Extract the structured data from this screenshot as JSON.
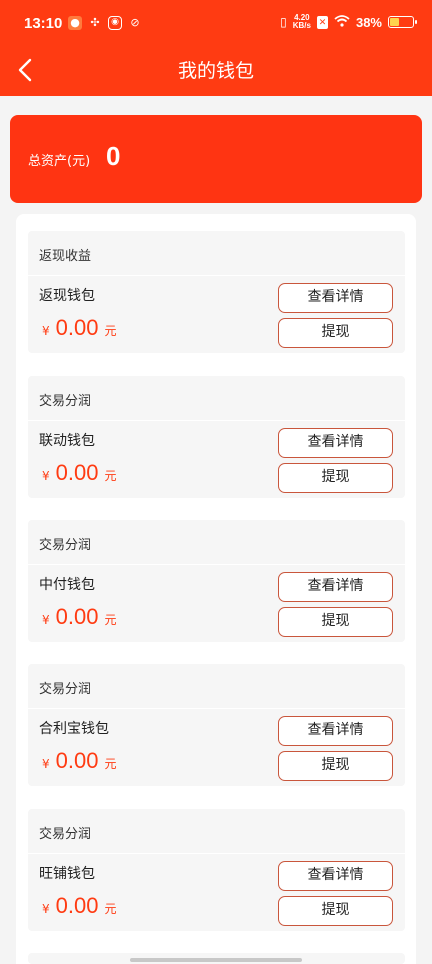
{
  "status_bar": {
    "time": "13:10",
    "net_speed_top": "4.20",
    "net_speed_bottom": "KB/s",
    "battery": "38%"
  },
  "header": {
    "title": "我的钱包",
    "back_icon": "chevron-left-icon"
  },
  "summary": {
    "label": "总资产(元)",
    "value": "0"
  },
  "wallets": [
    {
      "category": "返现收益",
      "name": "返现钱包",
      "currency": "¥",
      "amount": "0.00",
      "unit": "元",
      "detail_label": "查看详情",
      "withdraw_label": "提现"
    },
    {
      "category": "交易分润",
      "name": "联动钱包",
      "currency": "¥",
      "amount": "0.00",
      "unit": "元",
      "detail_label": "查看详情",
      "withdraw_label": "提现"
    },
    {
      "category": "交易分润",
      "name": "中付钱包",
      "currency": "¥",
      "amount": "0.00",
      "unit": "元",
      "detail_label": "查看详情",
      "withdraw_label": "提现"
    },
    {
      "category": "交易分润",
      "name": "合利宝钱包",
      "currency": "¥",
      "amount": "0.00",
      "unit": "元",
      "detail_label": "查看详情",
      "withdraw_label": "提现"
    },
    {
      "category": "交易分润",
      "name": "旺铺钱包",
      "currency": "¥",
      "amount": "0.00",
      "unit": "元",
      "detail_label": "查看详情",
      "withdraw_label": "提现"
    }
  ],
  "colors": {
    "brand": "#ff3b12",
    "button_border": "#c9563c"
  }
}
